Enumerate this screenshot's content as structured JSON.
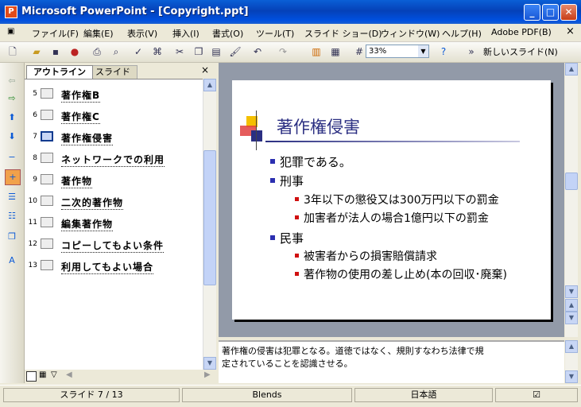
{
  "window": {
    "app_icon": "powerpoint-icon",
    "title": "Microsoft PowerPoint - [Copyright.ppt]",
    "buttons": {
      "minimize": "_",
      "maximize": "□",
      "close": "✕"
    }
  },
  "menu": {
    "items": [
      "ファイル(F)",
      "編集(E)",
      "表示(V)",
      "挿入(I)",
      "書式(O)",
      "ツール(T)",
      "スライド ショー(D)",
      "ウィンドウ(W)",
      "ヘルプ(H)",
      "Adobe PDF(B)"
    ],
    "close": "×"
  },
  "toolbar": {
    "zoom": "33%",
    "new_slide": "新しいスライド(N)"
  },
  "outline_pane": {
    "tabs": [
      "アウトライン",
      "スライド"
    ],
    "close": "×",
    "items": [
      {
        "num": "5",
        "text": "著作権B"
      },
      {
        "num": "6",
        "text": "著作権C"
      },
      {
        "num": "7",
        "text": "著作権侵害"
      },
      {
        "num": "8",
        "text": "ネットワークでの利用"
      },
      {
        "num": "9",
        "text": "著作物"
      },
      {
        "num": "10",
        "text": "二次的著作物"
      },
      {
        "num": "11",
        "text": "編集著作物"
      },
      {
        "num": "12",
        "text": "コピーしてもよい条件"
      },
      {
        "num": "13",
        "text": "利用してもよい場合"
      }
    ],
    "selected_index": 2
  },
  "slide": {
    "title": "著作権侵害",
    "bullets": [
      {
        "level": 1,
        "text": "犯罪である。"
      },
      {
        "level": 1,
        "text": "刑事"
      },
      {
        "level": 2,
        "text": "3年以下の懲役又は300万円以下の罰金"
      },
      {
        "level": 2,
        "text": "加害者が法人の場合1億円以下の罰金"
      },
      {
        "level": 1,
        "text": "民事"
      },
      {
        "level": 2,
        "text": "被害者からの損害賠償請求"
      },
      {
        "level": 2,
        "text": "著作物の使用の差し止め(本の回収･廃棄)"
      }
    ]
  },
  "notes": {
    "line1": "著作権の侵害は犯罪となる。道徳ではなく、規則すなわち法律で規",
    "line2": "定されていることを認識させる。"
  },
  "status": {
    "slide": "スライド 7 / 13",
    "design": "Blends",
    "language": "日本語"
  },
  "colors": {
    "title_bar": "#0a5fd6",
    "slide_title": "#2b2f82",
    "bullet1": "#2b2fb0",
    "bullet2": "#d01010"
  }
}
